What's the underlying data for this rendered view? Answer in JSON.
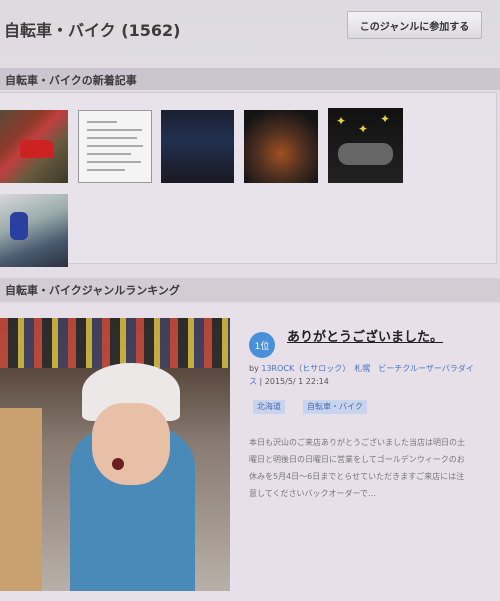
{
  "header": {
    "genre_title": "自転車・バイク (1562)",
    "join_button": "このジャンルに参加する"
  },
  "new_articles": {
    "heading": "自転車・バイクの新着記事"
  },
  "ranking": {
    "heading": "自転車・バイクジャンルランキング",
    "top": {
      "rank": "1位",
      "title": "ありがとうございました。",
      "by_prefix": "by",
      "author": "13ROCK（ヒサロック）　札幌　ビーチクルーザーパラダイス",
      "date": "| 2015/5/ 1 22:14",
      "tags": [
        "北海道",
        "自転車・バイク"
      ],
      "excerpt": "本日も沢山のご来店ありがとうございました当店は明日の土曜日と明後日の日曜日に営業をしてゴールデンウィークのお休みを5月4日～6日までとらせていただきますご来店には注意してくださいバックオーダーで..."
    }
  },
  "colors": {
    "accent_badge": "#4a90d9",
    "link": "#4a74c0"
  }
}
